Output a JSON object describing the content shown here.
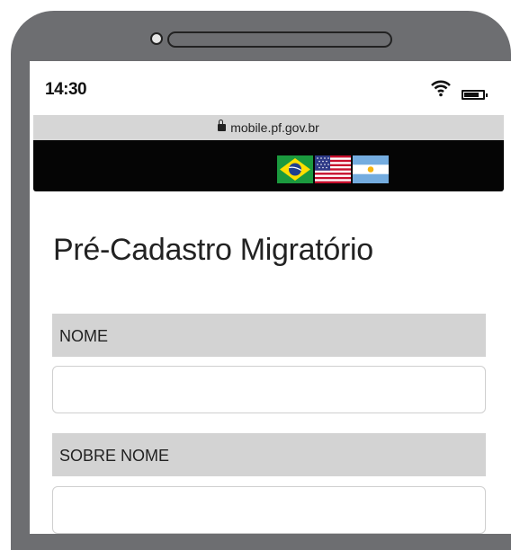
{
  "status": {
    "time": "14:30",
    "wifi_icon": "wifi-icon",
    "battery_icon": "battery-icon"
  },
  "browser": {
    "url": "mobile.pf.gov.br",
    "lock_icon": "lock-icon"
  },
  "header": {
    "flags": [
      "brazil-flag",
      "usa-flag",
      "argentina-flag"
    ]
  },
  "page": {
    "title": "Pré-Cadastro Migratório",
    "fields": [
      {
        "label": "NOME",
        "value": "",
        "placeholder": ""
      },
      {
        "label": "SOBRE NOME",
        "value": "",
        "placeholder": ""
      }
    ]
  }
}
